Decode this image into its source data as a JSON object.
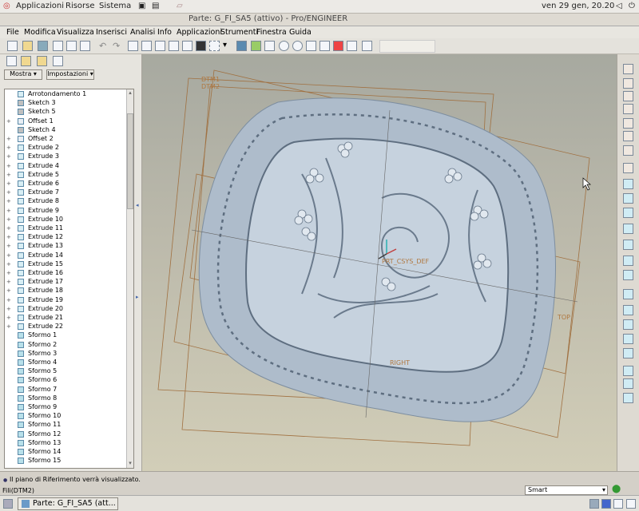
{
  "top_panel": {
    "applications": "Applicazioni",
    "places": "Risorse",
    "system": "Sistema",
    "clock": "ven 29 gen, 20.20"
  },
  "window": {
    "title": "Parte: G_FI_SA5 (attivo) - Pro/ENGINEER"
  },
  "menu": [
    "File",
    "Modifica",
    "Visualizza",
    "Inserisci",
    "Analisi",
    "Info",
    "Applicazioni",
    "Strumenti",
    "Finestra",
    "Guida"
  ],
  "panel": {
    "show_button": "Mostra",
    "settings_button": "Impostazioni"
  },
  "tree": [
    {
      "label": "Arrotondamento 1",
      "type": "round"
    },
    {
      "label": "Sketch 3",
      "type": "sketch"
    },
    {
      "label": "Sketch 5",
      "type": "sketch"
    },
    {
      "label": "Offset 1",
      "type": "offset"
    },
    {
      "label": "Sketch 4",
      "type": "sketch"
    },
    {
      "label": "Offset 2",
      "type": "offset"
    },
    {
      "label": "Extrude 2",
      "type": "extrude"
    },
    {
      "label": "Extrude 3",
      "type": "extrude"
    },
    {
      "label": "Extrude 4",
      "type": "extrude"
    },
    {
      "label": "Extrude 5",
      "type": "extrude"
    },
    {
      "label": "Extrude 6",
      "type": "extrude"
    },
    {
      "label": "Extrude 7",
      "type": "extrude"
    },
    {
      "label": "Extrude 8",
      "type": "extrude"
    },
    {
      "label": "Extrude 9",
      "type": "extrude"
    },
    {
      "label": "Extrude 10",
      "type": "extrude"
    },
    {
      "label": "Extrude 11",
      "type": "extrude"
    },
    {
      "label": "Extrude 12",
      "type": "extrude"
    },
    {
      "label": "Extrude 13",
      "type": "extrude"
    },
    {
      "label": "Extrude 14",
      "type": "extrude"
    },
    {
      "label": "Extrude 15",
      "type": "extrude"
    },
    {
      "label": "Extrude 16",
      "type": "extrude"
    },
    {
      "label": "Extrude 17",
      "type": "extrude"
    },
    {
      "label": "Extrude 18",
      "type": "extrude"
    },
    {
      "label": "Extrude 19",
      "type": "extrude"
    },
    {
      "label": "Extrude 20",
      "type": "extrude"
    },
    {
      "label": "Extrude 21",
      "type": "extrude"
    },
    {
      "label": "Extrude 22",
      "type": "extrude"
    },
    {
      "label": "Sformo 1",
      "type": "draft"
    },
    {
      "label": "Sformo 2",
      "type": "draft"
    },
    {
      "label": "Sformo 3",
      "type": "draft"
    },
    {
      "label": "Sformo 4",
      "type": "draft"
    },
    {
      "label": "Sformo 5",
      "type": "draft"
    },
    {
      "label": "Sformo 6",
      "type": "draft"
    },
    {
      "label": "Sformo 7",
      "type": "draft"
    },
    {
      "label": "Sformo 8",
      "type": "draft"
    },
    {
      "label": "Sformo 9",
      "type": "draft"
    },
    {
      "label": "Sformo 10",
      "type": "draft"
    },
    {
      "label": "Sformo 11",
      "type": "draft"
    },
    {
      "label": "Sformo 12",
      "type": "draft"
    },
    {
      "label": "Sformo 13",
      "type": "draft"
    },
    {
      "label": "Sformo 14",
      "type": "draft"
    },
    {
      "label": "Sformo 15",
      "type": "draft"
    }
  ],
  "canvas": {
    "datum_labels": {
      "dtm1": "DTM1",
      "dtm2": "DTM2",
      "csys": "PRT_CSYS_DEF",
      "right": "RIGHT",
      "top": "TOP"
    }
  },
  "status": {
    "message": "Il piano di Riferimento verrà visualizzato.",
    "selection": "Fili(DTM2)",
    "filter": "Smart"
  },
  "taskbar": {
    "window_button": "Parte: G_FI_SA5 (att..."
  },
  "colors": {
    "model": "#aebccb",
    "datum": "#c08040",
    "background": "#bab8aa"
  }
}
